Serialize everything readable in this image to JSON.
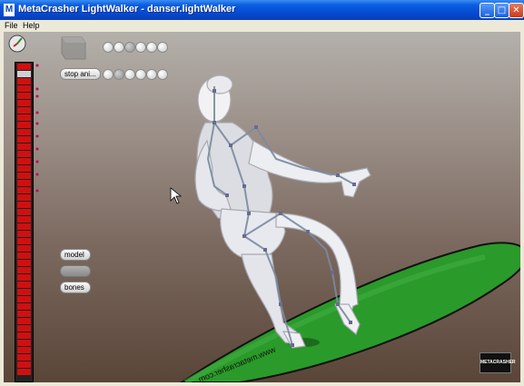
{
  "window": {
    "title": "MetaCrasher LightWalker - danser.lightWalker",
    "controls": {
      "minimize": "_",
      "maximize": "□",
      "close": "✕"
    }
  },
  "menu": [
    "File",
    "Help"
  ],
  "toolbar": {
    "stop_animation_label": "stop ani..."
  },
  "side_buttons": {
    "model_label": "model",
    "bones_label": "bones"
  },
  "floor_text": "www.metacrasher.com",
  "logo_text": "METACRASHER",
  "icons": {
    "compass": "compass-icon",
    "cube": "cube-icon",
    "cursor": "mouse-cursor-icon"
  },
  "colors": {
    "title_blue": "#0548d0",
    "meter_red": "#d01010",
    "floor_green": "#2a9a2a",
    "bone_line": "#7a8aa0"
  }
}
